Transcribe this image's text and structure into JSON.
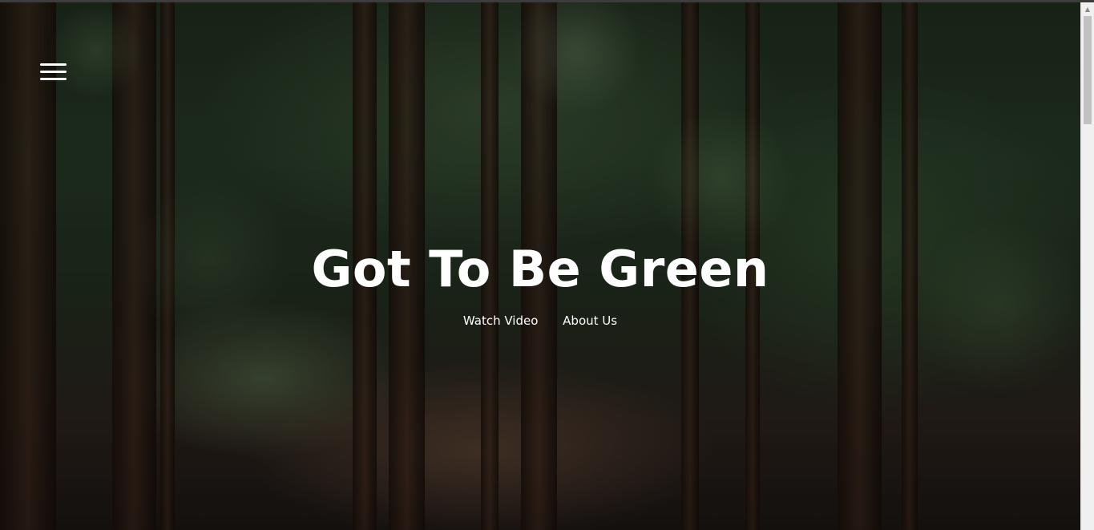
{
  "hero": {
    "title": "Got To Be Green",
    "links": [
      {
        "label": "Watch Video"
      },
      {
        "label": "About Us"
      }
    ]
  },
  "menu": {
    "icon": "hamburger-menu-icon"
  },
  "scrollbar": {
    "up_arrow_glyph": "▲"
  },
  "colors": {
    "text": "#ffffff",
    "scrollbar_track": "#f0f0f0",
    "scrollbar_thumb": "#c1c1c1"
  }
}
